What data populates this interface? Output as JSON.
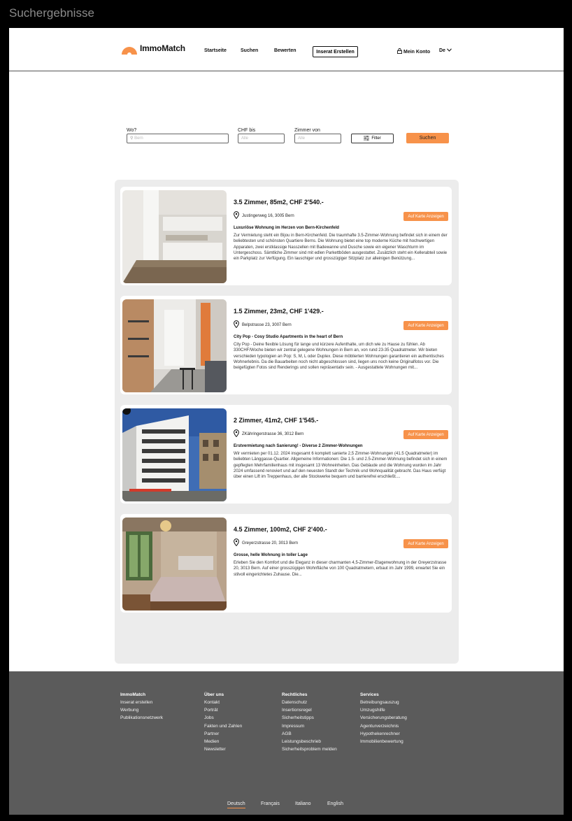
{
  "frame_title": "Suchergebnisse",
  "brand": {
    "name": "ImmoMatch",
    "accent": "#f7924a"
  },
  "nav": {
    "home": "Startseite",
    "search": "Suchen",
    "rate": "Bewerten",
    "create_listing": "Inserat Erstellen",
    "account": "Mein Konto",
    "language": "De"
  },
  "search": {
    "where_label": "Wo?",
    "where_placeholder": "Bern",
    "price_label": "CHF bis",
    "price_placeholder": "Alle",
    "rooms_label": "Zimmer von",
    "rooms_placeholder": "Alle",
    "filter_label": "Filter",
    "submit_label": "Suchen"
  },
  "results": [
    {
      "title": "3.5 Zimmer, 85m2, CHF 2'540.-",
      "address": "Justingerweg 16, 3005 Bern",
      "map_button": "Auf Karte Anzeigen",
      "subtitle": "Luxuriöse Wohnung im Herzen von Bern-Kirchenfeld",
      "description": "Zur Vermietung steht ein Bijou in Bern-Kirchenfeld. Die traumhafte 3.5-Zimmer-Wohnung befindet sich in einem der beliebtesten und schönsten Quartiere Berns. Die Wohnung bietet eine top moderne Küche mit hochwertigen Apparaten, zwei erstklassige Nasszellen mit Badewanne und Dusche sowie ein eigener Waschturm im Untergeschoss. Sämtliche Zimmer sind mit edlen Parkettböden ausgestattet. Zusätzlich steht ein Kellerabteil sowie ein Parkplatz zur Verfügung. Ein lauschiger und grosszügiger Sitzplatz zur alleinigen Benützung...",
      "image": "kitchen-photo"
    },
    {
      "title": "1.5 Zimmer, 23m2, CHF 1'429.-",
      "address": "Belpstrasse 23, 3007 Bern",
      "map_button": "Auf Karte Anzeigen",
      "subtitle": "City Pop - Cosy Studio Apartments in the heart of Bern",
      "description": "City Pop - Deine flexible Lösung für lange und kürzere Aufenthalte, um dich wie zu Hause zu fühlen. Ab 330CHF/Woche bieten wir zentral gelegene Wohnungen in Bern an, von rund 23-35 Quadratmeter. Wir bieten verschieden typologien an Pop: S, M, L oder Duplex. Diese möblierten Wohnungen garantieren ein authentisches Wohnerlebnis. Da die Bauarbeiten noch nicht abgeschlossen sind, liegen uns noch keine Originalfotos vor. Die beigefügten Fotos sind Renderings und sollen repräsentativ sein. - Ausgestattete Wohnungen mit...",
      "image": "studio-photo"
    },
    {
      "title": "2 Zimmer, 41m2, CHF 1'545.-",
      "address": "ZKähringerstrasse 36, 3012 Bern",
      "map_button": "Auf Karte Anzeigen",
      "subtitle": "Erstvermietung nach Sanierung! - Diverse 2 Zimmer-Wohnungen",
      "description": "Wir vermieten per 01.12. 2024 insgesamt 6 komplett sanierte 2,5 Zimmer-Wohnungen (41.5 Quadratmeter) im beliebten Länggasse-Quartier. Allgemeine Informationen: Die 1.5- und 2.5-Zimmer-Wohnung befindet sich in einem gepflegten Mehrfamilienhaus mit insgesamt 13 Wohneinheiten. Das Gebäude und die Wohnung wurden im Jahr 2024 umfassend renoviert und auf den neuesten Standt der Technik und Wohnqualität gebracht. Das Haus verfügt über einen Lift im Treppenhaus, der alle Stockwerke bequem und barrierefrei erschließt....",
      "image": "building-photo"
    },
    {
      "title": "4.5 Zimmer, 100m2, CHF 2'400.-",
      "address": "Greyerzstrasse 20, 3013 Bern",
      "map_button": "Auf Karte Anzeigen",
      "subtitle": "Grosse, helle Wohnung in toller Lage",
      "description": "Erleben Sie den Komfort und die Eleganz in dieser charmanten 4,5-Zimmer-Etagenwohnung in der Greyerzstrasse 20, 3013 Bern. Auf einer grosszügigen Wohnfläche von 100 Quadratmetern, erbaut im Jahr 1999, erwartet Sie ein stilvoll eingerichtetes Zuhause. Die...",
      "image": "bedroom-photo"
    }
  ],
  "footer": {
    "columns": [
      {
        "heading": "ImmoMatch",
        "items": [
          "Inserat erstellen",
          "Werbung",
          "Publikationsnetzwerk"
        ]
      },
      {
        "heading": "Über uns",
        "items": [
          "Kontakt",
          "Porträt",
          "Jobs",
          "Fakten und Zahlen",
          "Partner",
          "Medien",
          "Newsletter"
        ]
      },
      {
        "heading": "Rechtliches",
        "items": [
          "Datenschutz",
          "Insertionsregel",
          "Sicherheitstipps",
          "Impressum",
          "AGB",
          "Leistungsbeschrieb",
          "Sicherheitsproblem melden"
        ]
      },
      {
        "heading": "Services",
        "items": [
          "Betreibungsauszug",
          "Umzugshilfe",
          "Versicherungsberatung",
          "Agenturverzeichnis",
          "Hypothekenrechner",
          "Immobilienbewertung"
        ]
      }
    ],
    "languages": [
      "Deutsch",
      "Français",
      "Italiano",
      "English"
    ],
    "active_language": "Deutsch"
  }
}
